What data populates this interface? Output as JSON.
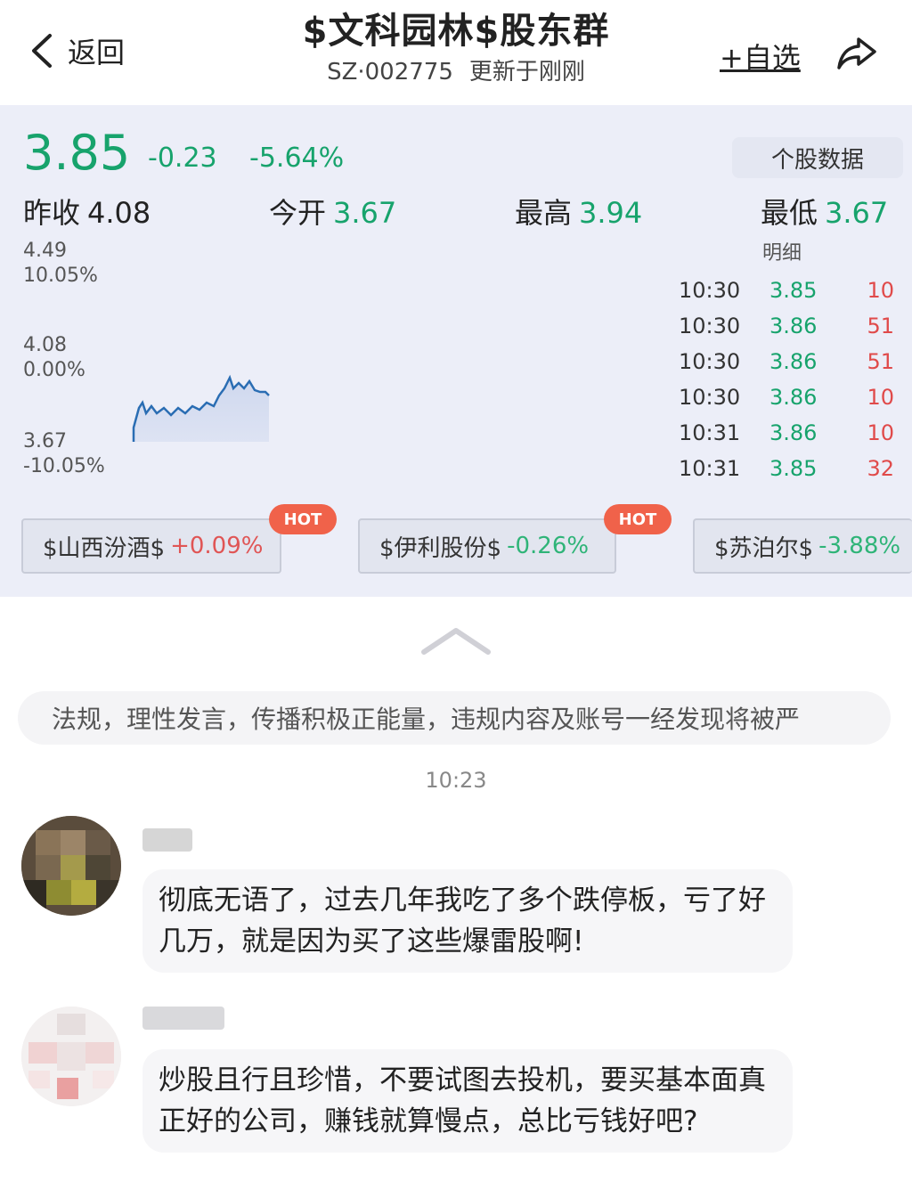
{
  "header": {
    "back_label": "返回",
    "title": "$文科园林$股东群",
    "code": "SZ·002775",
    "updated": "更新于刚刚",
    "add_watchlist": "+自选"
  },
  "quote": {
    "price": "3.85",
    "change": "-0.23",
    "change_pct": "-5.64%",
    "stock_data_button": "个股数据",
    "prev_close_label": "昨收",
    "prev_close": "4.08",
    "open_label": "今开",
    "open": "3.67",
    "high_label": "最高",
    "high": "3.94",
    "low_label": "最低",
    "low": "3.67"
  },
  "chart": {
    "top_price": "4.49",
    "top_pct": "10.05%",
    "mid_price": "4.08",
    "mid_pct": "0.00%",
    "bottom_price": "3.67",
    "bottom_pct": "-10.05%",
    "line_color": "#2a6db3",
    "up_color": "#e04a4a",
    "down_color": "#17a36c"
  },
  "details": {
    "title": "明细",
    "rows": [
      {
        "time": "10:30",
        "price": "3.85",
        "qty": "10"
      },
      {
        "time": "10:30",
        "price": "3.86",
        "qty": "51"
      },
      {
        "time": "10:30",
        "price": "3.86",
        "qty": "51"
      },
      {
        "time": "10:30",
        "price": "3.86",
        "qty": "10"
      },
      {
        "time": "10:31",
        "price": "3.86",
        "qty": "10"
      },
      {
        "time": "10:31",
        "price": "3.85",
        "qty": "32"
      }
    ]
  },
  "hot_chips": [
    {
      "name": "$山西汾酒$",
      "pct": "+0.09%",
      "hot": "HOT"
    },
    {
      "name": "$伊利股份$",
      "pct": "-0.26%",
      "hot": "HOT"
    },
    {
      "name": "$苏泊尔$",
      "pct": "-3.88%"
    }
  ],
  "chat": {
    "notice": "法规，理性发言，传播积极正能量，违规内容及账号一经发现将被严",
    "time": "10:23",
    "messages": [
      {
        "text": "彻底无语了，过去几年我吃了多个跌停板，亏了好几万，就是因为买了这些爆雷股啊!"
      },
      {
        "text": "炒股且行且珍惜，不要试图去投机，要买基本面真正好的公司，赚钱就算慢点，总比亏钱好吧?"
      }
    ]
  }
}
